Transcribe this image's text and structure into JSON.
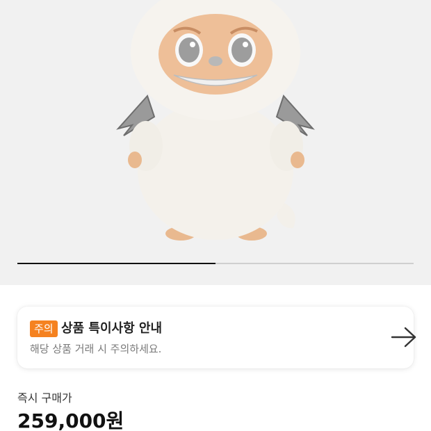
{
  "gallery": {
    "product_image": "white-furry-monster-plush-figure-with-silver-wings",
    "slide_progress": 0.5
  },
  "notice": {
    "badge": "주의",
    "title": "상품 특이사항 안내",
    "description": "해당 상품 거래 시 주의하세요.",
    "action_icon": "arrow-right-icon"
  },
  "price": {
    "label": "즉시 구매가",
    "value": "259,000원"
  },
  "colors": {
    "badge_bg": "#f58220",
    "gallery_bg": "#f1f1f1"
  }
}
